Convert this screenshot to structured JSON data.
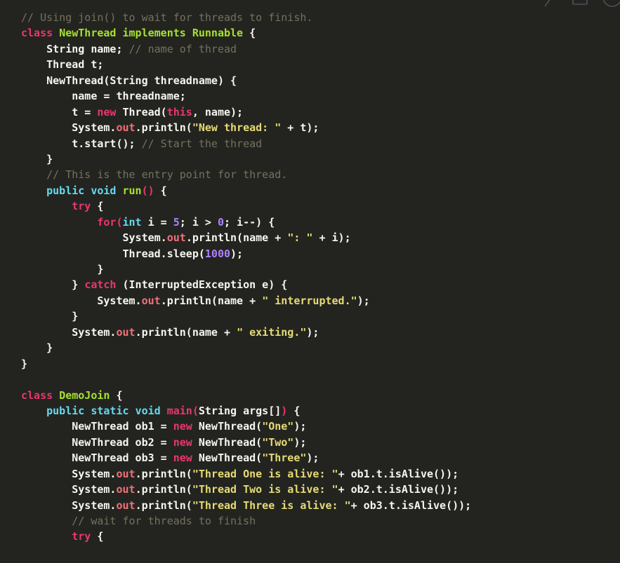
{
  "editor": {
    "theme_name": "monokai-dark",
    "language": "java",
    "background_color": "#232420",
    "default_text_color": "#f6f6ef",
    "font_size_px": 15,
    "line_height_px": 22.45
  },
  "colors": {
    "comment": "#75715e",
    "keyword": "#e8376f",
    "type": "#66d9ef",
    "class_name": "#a6e22e",
    "function": "#e8376f",
    "string": "#e6db74",
    "number": "#ae81ff",
    "property": "#f07178",
    "plain": "#f6f6ef"
  },
  "window_chrome": {
    "minimize_icon": "minimize-icon",
    "maximize_icon": "maximize-icon",
    "close_icon": "close-icon"
  },
  "code": {
    "lines": [
      {
        "indent": 0,
        "tokens": [
          {
            "t": "cmt",
            "v": "// Using join() to wait for threads to finish."
          }
        ]
      },
      {
        "indent": 0,
        "tokens": [
          {
            "t": "key",
            "v": "class"
          },
          {
            "t": "txt",
            "v": " "
          },
          {
            "t": "cls",
            "v": "NewThread"
          },
          {
            "t": "txt",
            "v": " "
          },
          {
            "t": "cls",
            "v": "implements"
          },
          {
            "t": "txt",
            "v": " "
          },
          {
            "t": "cls",
            "v": "Runnable"
          },
          {
            "t": "txt",
            "v": " {"
          }
        ]
      },
      {
        "indent": 1,
        "tokens": [
          {
            "t": "txt",
            "v": "String name; "
          },
          {
            "t": "cmt",
            "v": "// name of thread"
          }
        ]
      },
      {
        "indent": 1,
        "tokens": [
          {
            "t": "txt",
            "v": "Thread t;"
          }
        ]
      },
      {
        "indent": 1,
        "tokens": [
          {
            "t": "txt",
            "v": "NewThread(String threadname) {"
          }
        ]
      },
      {
        "indent": 2,
        "tokens": [
          {
            "t": "txt",
            "v": "name = threadname;"
          }
        ]
      },
      {
        "indent": 2,
        "tokens": [
          {
            "t": "txt",
            "v": "t = "
          },
          {
            "t": "key",
            "v": "new"
          },
          {
            "t": "txt",
            "v": " Thread("
          },
          {
            "t": "key",
            "v": "this"
          },
          {
            "t": "txt",
            "v": ", name);"
          }
        ]
      },
      {
        "indent": 2,
        "tokens": [
          {
            "t": "txt",
            "v": "System."
          },
          {
            "t": "prop",
            "v": "out"
          },
          {
            "t": "txt",
            "v": ".println("
          },
          {
            "t": "str",
            "v": "\"New thread: \""
          },
          {
            "t": "txt",
            "v": " + t);"
          }
        ]
      },
      {
        "indent": 2,
        "tokens": [
          {
            "t": "txt",
            "v": "t.start(); "
          },
          {
            "t": "cmt",
            "v": "// Start the thread"
          }
        ]
      },
      {
        "indent": 1,
        "tokens": [
          {
            "t": "txt",
            "v": "}"
          }
        ]
      },
      {
        "indent": 1,
        "tokens": [
          {
            "t": "cmt",
            "v": "// This is the entry point for thread."
          }
        ]
      },
      {
        "indent": 1,
        "tokens": [
          {
            "t": "type",
            "v": "public"
          },
          {
            "t": "txt",
            "v": " "
          },
          {
            "t": "type",
            "v": "void"
          },
          {
            "t": "txt",
            "v": " "
          },
          {
            "t": "cls",
            "v": "run"
          },
          {
            "t": "punc",
            "v": "()"
          },
          {
            "t": "txt",
            "v": " {"
          }
        ]
      },
      {
        "indent": 2,
        "tokens": [
          {
            "t": "key",
            "v": "try"
          },
          {
            "t": "txt",
            "v": " {"
          }
        ]
      },
      {
        "indent": 3,
        "tokens": [
          {
            "t": "key",
            "v": "for"
          },
          {
            "t": "punc",
            "v": "("
          },
          {
            "t": "type",
            "v": "int"
          },
          {
            "t": "txt",
            "v": " i = "
          },
          {
            "t": "num",
            "v": "5"
          },
          {
            "t": "txt",
            "v": "; i > "
          },
          {
            "t": "num",
            "v": "0"
          },
          {
            "t": "txt",
            "v": "; i--) {"
          }
        ]
      },
      {
        "indent": 4,
        "tokens": [
          {
            "t": "txt",
            "v": "System."
          },
          {
            "t": "prop",
            "v": "out"
          },
          {
            "t": "txt",
            "v": ".println(name + "
          },
          {
            "t": "str",
            "v": "\": \""
          },
          {
            "t": "txt",
            "v": " + i);"
          }
        ]
      },
      {
        "indent": 4,
        "tokens": [
          {
            "t": "txt",
            "v": "Thread.sleep("
          },
          {
            "t": "num",
            "v": "1000"
          },
          {
            "t": "txt",
            "v": ");"
          }
        ]
      },
      {
        "indent": 3,
        "tokens": [
          {
            "t": "txt",
            "v": "}"
          }
        ]
      },
      {
        "indent": 2,
        "tokens": [
          {
            "t": "txt",
            "v": "} "
          },
          {
            "t": "key",
            "v": "catch"
          },
          {
            "t": "txt",
            "v": " (InterruptedException e) {"
          }
        ]
      },
      {
        "indent": 3,
        "tokens": [
          {
            "t": "txt",
            "v": "System."
          },
          {
            "t": "prop",
            "v": "out"
          },
          {
            "t": "txt",
            "v": ".println(name + "
          },
          {
            "t": "str",
            "v": "\" interrupted.\""
          },
          {
            "t": "txt",
            "v": ");"
          }
        ]
      },
      {
        "indent": 2,
        "tokens": [
          {
            "t": "txt",
            "v": "}"
          }
        ]
      },
      {
        "indent": 2,
        "tokens": [
          {
            "t": "txt",
            "v": "System."
          },
          {
            "t": "prop",
            "v": "out"
          },
          {
            "t": "txt",
            "v": ".println(name + "
          },
          {
            "t": "str",
            "v": "\" exiting.\""
          },
          {
            "t": "txt",
            "v": ");"
          }
        ]
      },
      {
        "indent": 1,
        "tokens": [
          {
            "t": "txt",
            "v": "}"
          }
        ]
      },
      {
        "indent": 0,
        "tokens": [
          {
            "t": "txt",
            "v": "}"
          }
        ]
      },
      {
        "indent": 0,
        "tokens": []
      },
      {
        "indent": 0,
        "tokens": [
          {
            "t": "key",
            "v": "class"
          },
          {
            "t": "txt",
            "v": " "
          },
          {
            "t": "cls",
            "v": "DemoJoin"
          },
          {
            "t": "txt",
            "v": " {"
          }
        ]
      },
      {
        "indent": 1,
        "tokens": [
          {
            "t": "type",
            "v": "public"
          },
          {
            "t": "txt",
            "v": " "
          },
          {
            "t": "type",
            "v": "static"
          },
          {
            "t": "txt",
            "v": " "
          },
          {
            "t": "type",
            "v": "void"
          },
          {
            "t": "txt",
            "v": " "
          },
          {
            "t": "fn",
            "v": "main"
          },
          {
            "t": "punc",
            "v": "("
          },
          {
            "t": "txt",
            "v": "String args[]"
          },
          {
            "t": "punc",
            "v": ")"
          },
          {
            "t": "txt",
            "v": " {"
          }
        ]
      },
      {
        "indent": 2,
        "tokens": [
          {
            "t": "txt",
            "v": "NewThread ob1 = "
          },
          {
            "t": "key",
            "v": "new"
          },
          {
            "t": "txt",
            "v": " NewThread("
          },
          {
            "t": "str",
            "v": "\"One\""
          },
          {
            "t": "txt",
            "v": ");"
          }
        ]
      },
      {
        "indent": 2,
        "tokens": [
          {
            "t": "txt",
            "v": "NewThread ob2 = "
          },
          {
            "t": "key",
            "v": "new"
          },
          {
            "t": "txt",
            "v": " NewThread("
          },
          {
            "t": "str",
            "v": "\"Two\""
          },
          {
            "t": "txt",
            "v": ");"
          }
        ]
      },
      {
        "indent": 2,
        "tokens": [
          {
            "t": "txt",
            "v": "NewThread ob3 = "
          },
          {
            "t": "key",
            "v": "new"
          },
          {
            "t": "txt",
            "v": " NewThread("
          },
          {
            "t": "str",
            "v": "\"Three\""
          },
          {
            "t": "txt",
            "v": ");"
          }
        ]
      },
      {
        "indent": 2,
        "tokens": [
          {
            "t": "txt",
            "v": "System."
          },
          {
            "t": "prop",
            "v": "out"
          },
          {
            "t": "txt",
            "v": ".println("
          },
          {
            "t": "str",
            "v": "\"Thread One is alive: \""
          },
          {
            "t": "txt",
            "v": "+ ob1.t.isAlive());"
          }
        ]
      },
      {
        "indent": 2,
        "tokens": [
          {
            "t": "txt",
            "v": "System."
          },
          {
            "t": "prop",
            "v": "out"
          },
          {
            "t": "txt",
            "v": ".println("
          },
          {
            "t": "str",
            "v": "\"Thread Two is alive: \""
          },
          {
            "t": "txt",
            "v": "+ ob2.t.isAlive());"
          }
        ]
      },
      {
        "indent": 2,
        "tokens": [
          {
            "t": "txt",
            "v": "System."
          },
          {
            "t": "prop",
            "v": "out"
          },
          {
            "t": "txt",
            "v": ".println("
          },
          {
            "t": "str",
            "v": "\"Thread Three is alive: \""
          },
          {
            "t": "txt",
            "v": "+ ob3.t.isAlive());"
          }
        ]
      },
      {
        "indent": 2,
        "tokens": [
          {
            "t": "cmt",
            "v": "// wait for threads to finish"
          }
        ]
      },
      {
        "indent": 2,
        "tokens": [
          {
            "t": "key",
            "v": "try"
          },
          {
            "t": "txt",
            "v": " {"
          }
        ]
      }
    ]
  }
}
